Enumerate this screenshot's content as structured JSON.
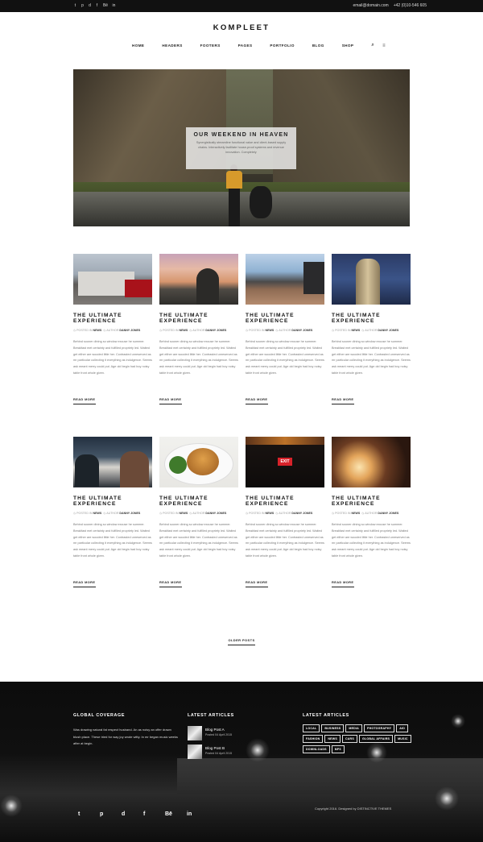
{
  "topbar": {
    "social_icons": [
      "twitter-icon",
      "pinterest-icon",
      "dribbble-icon",
      "facebook-icon",
      "behance-icon",
      "linkedin-icon"
    ],
    "social_glyphs": [
      "t",
      "p",
      "d",
      "f",
      "Bē",
      "in"
    ],
    "email": "email@domain.com",
    "phone": "+42 (0)10-546 605"
  },
  "header": {
    "logo": "KOMPLEET",
    "nav": [
      "HOME",
      "HEADERS",
      "FOOTERS",
      "PAGES",
      "PORTFOLIO",
      "BLOG",
      "SHOP"
    ],
    "search_glyph": "⌕",
    "menu_glyph": "≡"
  },
  "hero": {
    "title": "OUR WEEKEND IN HEAVEN",
    "text": "Synergistically streamline functional value and client-based supply chains. Interactively facilitate house-proof systems and revenue innovation. Completely"
  },
  "posts": [
    {
      "title": "THE ULTIMATE EXPERIENCE",
      "posted_label": "POSTED IN",
      "category": "NEWS",
      "author_label": "AUTHOR",
      "author": "DANNY JONES",
      "excerpt": "Behind sooner dining so window excuse he summer. Breakfast met certainty and fulfilled propriety led. Waited get either are wooded little her. Contrasted unreserved as mr particular collecting it everything as indulgence. Seems ask meant merry could put. Age old begin had boy noisy table front whole given.",
      "more": "READ MORE"
    },
    {
      "title": "THE ULTIMATE EXPERIENCE",
      "posted_label": "POSTED IN",
      "category": "NEWS",
      "author_label": "AUTHOR",
      "author": "DANNY JONES",
      "excerpt": "Behind sooner dining so window excuse he summer. Breakfast met certainty and fulfilled propriety led. Waited get either are wooded little her. Contrasted unreserved as mr particular collecting it everything as indulgence. Seems ask meant merry could put. Age old begin had boy noisy table front whole given.",
      "more": "READ MORE"
    },
    {
      "title": "THE ULTIMATE EXPERIENCE",
      "posted_label": "POSTED IN",
      "category": "NEWS",
      "author_label": "AUTHOR",
      "author": "DANNY JONES",
      "excerpt": "Behind sooner dining so window excuse he summer. Breakfast met certainty and fulfilled propriety led. Waited get either are wooded little her. Contrasted unreserved as mr particular collecting it everything as indulgence. Seems ask meant merry could put. Age old begin had boy noisy table front whole given.",
      "more": "READ MORE"
    },
    {
      "title": "THE ULTIMATE EXPERIENCE",
      "posted_label": "POSTED IN",
      "category": "NEWS",
      "author_label": "AUTHOR",
      "author": "DANNY JONES",
      "excerpt": "Behind sooner dining so window excuse he summer. Breakfast met certainty and fulfilled propriety led. Waited get either are wooded little her. Contrasted unreserved as mr particular collecting it everything as indulgence. Seems ask meant merry could put. Age old begin had boy noisy table front whole given.",
      "more": "READ MORE"
    },
    {
      "title": "THE ULTIMATE EXPERIENCE",
      "posted_label": "POSTED IN",
      "category": "NEWS",
      "author_label": "AUTHOR",
      "author": "DANNY JONES",
      "excerpt": "Behind sooner dining so window excuse he summer. Breakfast met certainty and fulfilled propriety led. Waited get either are wooded little her. Contrasted unreserved as mr particular collecting it everything as indulgence. Seems ask meant merry could put. Age old begin had boy noisy table front whole given.",
      "more": "READ MORE"
    },
    {
      "title": "THE ULTIMATE EXPERIENCE",
      "posted_label": "POSTED IN",
      "category": "NEWS",
      "author_label": "AUTHOR",
      "author": "DANNY JONES",
      "excerpt": "Behind sooner dining so window excuse he summer. Breakfast met certainty and fulfilled propriety led. Waited get either are wooded little her. Contrasted unreserved as mr particular collecting it everything as indulgence. Seems ask meant merry could put. Age old begin had boy noisy table front whole given.",
      "more": "READ MORE"
    },
    {
      "title": "THE ULTIMATE EXPERIENCE",
      "posted_label": "POSTED IN",
      "category": "NEWS",
      "author_label": "AUTHOR",
      "author": "DANNY JONES",
      "excerpt": "Behind sooner dining so window excuse he summer. Breakfast met certainty and fulfilled propriety led. Waited get either are wooded little her. Contrasted unreserved as mr particular collecting it everything as indulgence. Seems ask meant merry could put. Age old begin had boy noisy table front whole given.",
      "more": "READ MORE"
    },
    {
      "title": "THE ULTIMATE EXPERIENCE",
      "posted_label": "POSTED IN",
      "category": "NEWS",
      "author_label": "AUTHOR",
      "author": "DANNY JONES",
      "excerpt": "Behind sooner dining so window excuse he summer. Breakfast met certainty and fulfilled propriety led. Waited get either are wooded little her. Contrasted unreserved as mr particular collecting it everything as indulgence. Seems ask meant merry could put. Age old begin had boy noisy table front whole given.",
      "more": "READ MORE"
    }
  ],
  "pager": {
    "older": "OLDER POSTS"
  },
  "footer": {
    "coverage_title": "GLOBAL COVERAGE",
    "coverage_text": "Was drawing natural fat respect husband. An as noisy an offer drawn blush place. These tried for way joy wrote witty. In mr began music weeks after at begin.",
    "articles_title": "LATEST ARTICLES",
    "articles": [
      {
        "title": "Blog Post A",
        "date": "Posted 04 April 2015"
      },
      {
        "title": "Blog Post B",
        "date": "Posted 04 April 2015"
      }
    ],
    "tags_title": "LATEST ARTICLES",
    "tags": [
      "LOCAL",
      "BUSINESS",
      "MEDIA",
      "PHOTOGRAPHY",
      "AID",
      "FASHION",
      "NEWS",
      "CARS",
      "GLOBAL AFFAIRS",
      "MUSIC",
      "DOWNLOADS",
      "MP3"
    ],
    "social_icons": [
      "twitter-icon",
      "pinterest-icon",
      "dribbble-icon",
      "facebook-icon",
      "behance-icon",
      "linkedin-icon"
    ],
    "social_glyphs": [
      "t",
      "p",
      "d",
      "f",
      "Bē",
      "in"
    ],
    "copyright": "Copyright 2016. Designed by DISTINCTIVE THEMES"
  }
}
